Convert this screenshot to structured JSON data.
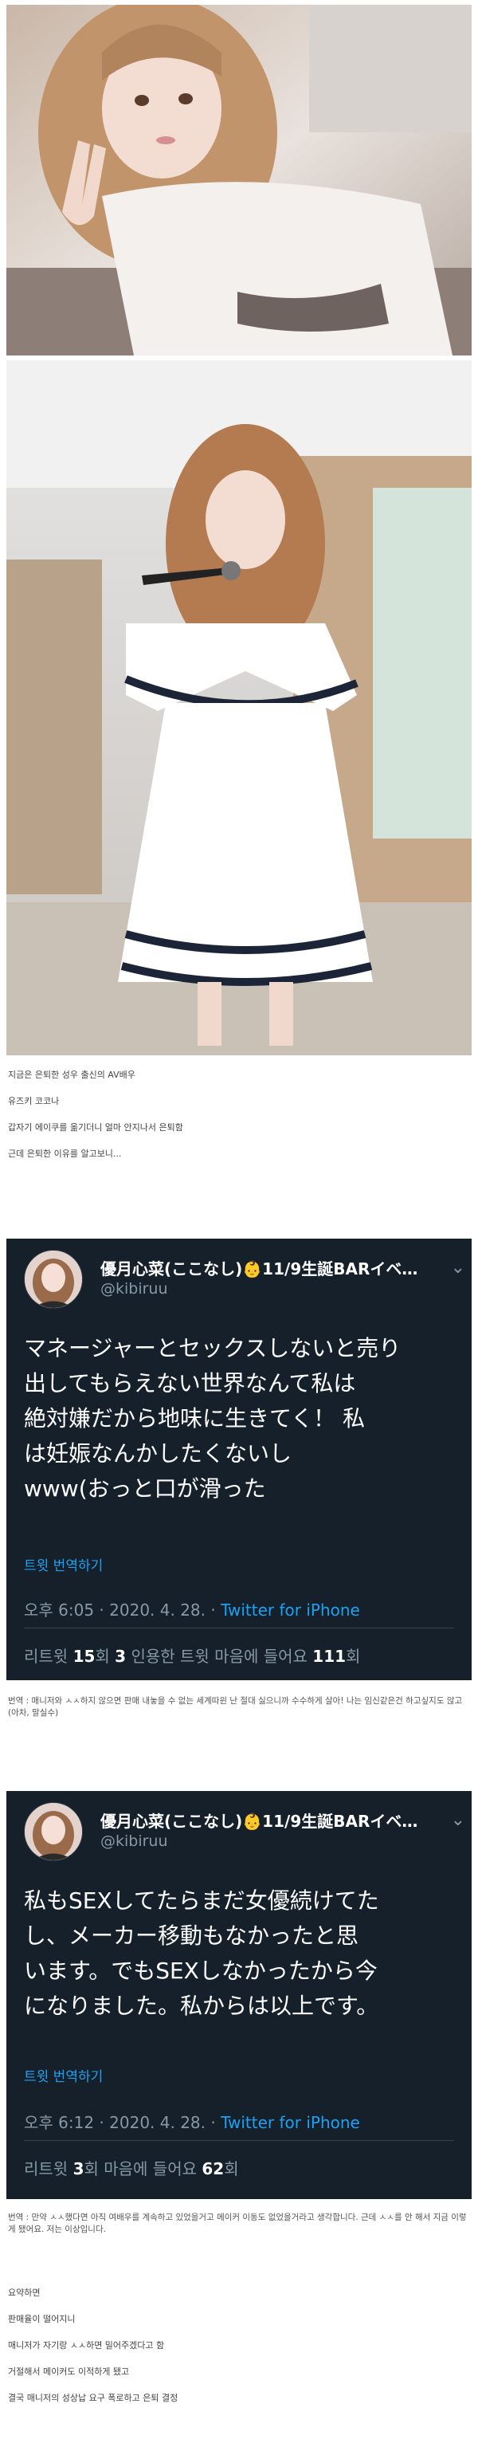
{
  "intro_lines": [
    "지금은 은퇴한 성우 출신의 AV배우",
    "유즈키 코코나",
    "갑자기 에이쿠를 옮기더니 얼마 안지나서 은퇴함",
    "근데 은퇴한 이유를 알고보니..."
  ],
  "tweet1": {
    "name": "優月心菜(ここなし)👶11/9生誕BARイベ…",
    "handle": "@kibiruu",
    "chevron": "⌄",
    "body_lines": [
      "マネージャーとセックスしないと売り",
      "出してもらえない世界なんて私は",
      "絶対嫌だから地味に生きてく！ 私",
      "は妊娠なんかしたくないし",
      "www(おっと口が滑った"
    ],
    "translate": "트윗 번역하기",
    "time": "오후 6:05 · 2020. 4. 28. · ",
    "source": "Twitter for iPhone",
    "retweets_label": "리트윗 ",
    "retweets": "15",
    "retweets_unit": "회  ",
    "quotes": "3",
    "quotes_label": " 인용한 트윗  마음에 들어요 ",
    "likes": "111",
    "likes_unit": "회"
  },
  "note1_lines": [
    "번역 : 매니저와 ㅅㅅ하지 않으면 판매 내놓을 수 없는 세계따윈 난 절대 싫으니까 수수하게 살아! 나는 임신같은건 하고싶지도 않고 (아차, 말실수)"
  ],
  "tweet2": {
    "name": "優月心菜(ここなし)👶11/9生誕BARイベ…",
    "handle": "@kibiruu",
    "chevron": "⌄",
    "body_lines": [
      "私もSEXしてたらまだ女優続けてた",
      "し、メーカー移動もなかったと思",
      "います。でもSEXしなかったから今",
      "になりました。私からは以上です。"
    ],
    "translate": "트윗 번역하기",
    "time": "오후 6:12 · 2020. 4. 28. · ",
    "source": "Twitter for iPhone",
    "retweets_label": "리트윗 ",
    "retweets": "3",
    "retweets_unit": "회  마음에 들어요 ",
    "likes": "62",
    "likes_unit": "회"
  },
  "note2_lines": [
    "번역 : 만약 ㅅㅅ했다면 아직 여배우를 계속하고 있었을거고 메이커 이동도 없었을거라고 생각합니다. 근데 ㅅㅅ를 안 해서 지금 이렇게 됐어요. 저는 이상입니다."
  ],
  "summary_lines": [
    "요약하면",
    "판매율이 떨어지니",
    "매니저가 자기랑 ㅅㅅ하면 밀어주겠다고 함",
    "거절해서 메이커도 이적하게 됐고",
    "결국 매니저의 성상납 요구 폭로하고 은퇴 결정"
  ],
  "colors": {
    "tweet_bg": "#15202b",
    "link": "#1da1f2",
    "muted": "#8899a6"
  }
}
